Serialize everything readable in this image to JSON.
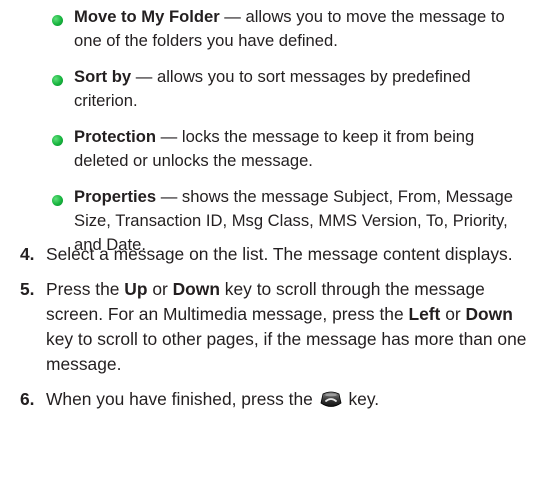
{
  "bullets": [
    {
      "term": "Move to My Folder",
      "desc": " — allows you to move the message to one of the folders you have defined."
    },
    {
      "term": "Sort by",
      "desc": " — allows you to sort messages by predefined criterion."
    },
    {
      "term": "Protection",
      "desc": " — locks the message to keep it from being deleted or unlocks the message."
    },
    {
      "term": "Properties",
      "desc": " — shows the message Subject, From, Message Size, Transaction ID, Msg Class, MMS Version, To, Priority, and Date."
    }
  ],
  "steps": {
    "s4": {
      "num": "4.",
      "text": "Select a message on the list. The message content displays."
    },
    "s5": {
      "num": "5.",
      "t1": "Press the ",
      "k1": "Up",
      "t2": " or ",
      "k2": "Down",
      "t3": " key to scroll through the message screen. For an Multimedia message, press the ",
      "k3": "Left",
      "t4": " or ",
      "k4": "Down",
      "t5": " key to scroll to other pages, if the message has more than one message."
    },
    "s6": {
      "num": "6.",
      "t1": "When you have finished, press the ",
      "t2": " key."
    }
  },
  "icons": {
    "end_key": "end-call-key-icon"
  }
}
